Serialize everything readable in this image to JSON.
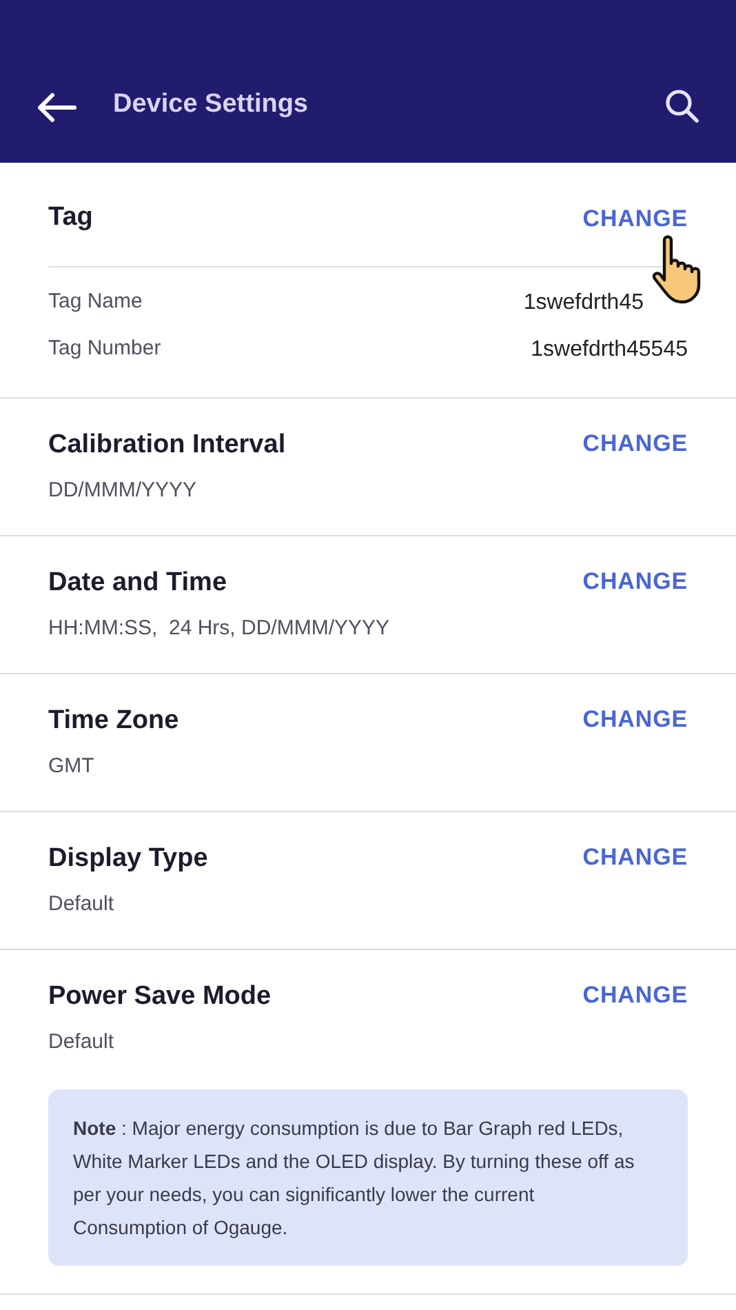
{
  "header": {
    "title": "Device Settings"
  },
  "tag": {
    "title": "Tag",
    "action": "CHANGE",
    "fields": [
      {
        "label": "Tag Name",
        "value": "1swefdrth45",
        "covered": true
      },
      {
        "label": "Tag Number",
        "value": "1swefdrth45545",
        "covered": false
      }
    ]
  },
  "settings": [
    {
      "title": "Calibration Interval",
      "value": "DD/MMM/YYYY",
      "action": "CHANGE"
    },
    {
      "title": "Date and Time",
      "value": "HH:MM:SS,  24 Hrs, DD/MMM/YYYY",
      "action": "CHANGE"
    },
    {
      "title": "Time Zone",
      "value": "GMT",
      "action": "CHANGE"
    },
    {
      "title": "Display Type",
      "value": "Default",
      "action": "CHANGE"
    },
    {
      "title": "Power Save Mode",
      "value": "Default",
      "action": "CHANGE",
      "note": "**Note** : Major energy consumption is due to Bar Graph red LEDs, White Marker LEDs and the OLED display. By turning these off as per your needs, you can significantly lower the current Consumption of Ogauge."
    }
  ]
}
